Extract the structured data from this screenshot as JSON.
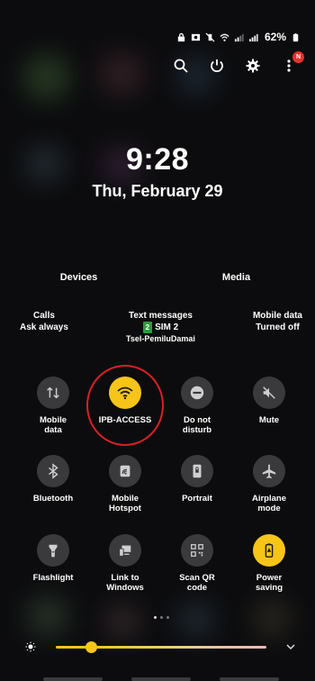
{
  "status_bar": {
    "battery_percent": "62%"
  },
  "notification_badge": "N",
  "lock": {
    "time": "9:28",
    "date": "Thu, February 29"
  },
  "panel_tabs": {
    "devices": "Devices",
    "media": "Media"
  },
  "info": {
    "calls_title": "Calls",
    "calls_value": "Ask always",
    "texts_title": "Text messages",
    "texts_sim_badge": "2",
    "texts_sim": "SIM 2",
    "texts_carrier": "Tsel-PemiluDamai",
    "data_title": "Mobile data",
    "data_value": "Turned off"
  },
  "tiles": {
    "mobile_data": {
      "line1": "Mobile",
      "line2": "data"
    },
    "wifi": {
      "line1": "IPB-ACCESS"
    },
    "dnd": {
      "line1": "Do not",
      "line2": "disturb"
    },
    "mute": {
      "line1": "Mute"
    },
    "bluetooth": {
      "line1": "Bluetooth"
    },
    "hotspot": {
      "line1": "Mobile",
      "line2": "Hotspot"
    },
    "portrait": {
      "line1": "Portrait"
    },
    "airplane": {
      "line1": "Airplane",
      "line2": "mode"
    },
    "flashlight": {
      "line1": "Flashlight"
    },
    "link_windows": {
      "line1": "Link to",
      "line2": "Windows"
    },
    "scan_qr": {
      "line1": "Scan QR",
      "line2": "code"
    },
    "power_saving": {
      "line1": "Power",
      "line2": "saving"
    }
  },
  "brightness_level": 0.17,
  "colors": {
    "accent": "#f6c518",
    "tile_off": "#3a3a3c",
    "highlight_ring": "#d92027"
  }
}
